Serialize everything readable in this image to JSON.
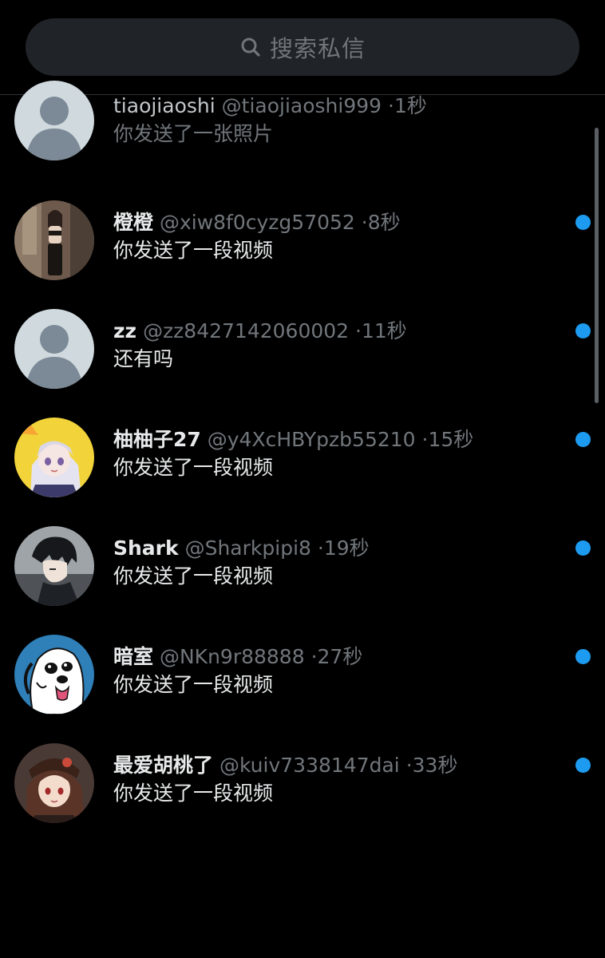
{
  "search": {
    "placeholder": "搜索私信",
    "icon": "search-icon"
  },
  "colors": {
    "background": "#000000",
    "search_bg": "#202327",
    "unread_dot": "#1d9bf0",
    "secondary_text": "#71767b"
  },
  "conversations": [
    {
      "name": "tiaojiaoshi",
      "handle": "@tiaojiaoshi999",
      "sep": "·",
      "time": "1秒",
      "preview": "你发送了一张照片",
      "unread": false,
      "avatar": "default-avatar-icon"
    },
    {
      "name": "橙橙",
      "handle": "@xiw8f0cyzg57052",
      "sep": "·",
      "time": "8秒",
      "preview": "你发送了一段视频",
      "unread": true,
      "avatar": "photo-avatar"
    },
    {
      "name": "zz",
      "handle": "@zz8427142060002",
      "sep": "·",
      "time": "11秒",
      "preview": "还有吗",
      "unread": true,
      "avatar": "default-avatar-icon"
    },
    {
      "name": "柚柚子27",
      "handle": "@y4XcHBYpzb55210",
      "sep": "·",
      "time": "15秒",
      "preview": "你发送了一段视频",
      "unread": true,
      "avatar": "anime-avatar"
    },
    {
      "name": "Shark",
      "handle": "@Sharkpipi8",
      "sep": "·",
      "time": "19秒",
      "preview": "你发送了一段视频",
      "unread": true,
      "avatar": "anime-avatar"
    },
    {
      "name": "暗室",
      "handle": "@NKn9r88888",
      "sep": "·",
      "time": "27秒",
      "preview": "你发送了一段视频",
      "unread": true,
      "avatar": "cartoon-dog-avatar"
    },
    {
      "name": "最爱胡桃了",
      "handle": "@kuiv7338147dai",
      "sep": "·",
      "time": "33秒",
      "preview": "你发送了一段视频",
      "unread": true,
      "avatar": "anime-avatar"
    }
  ]
}
